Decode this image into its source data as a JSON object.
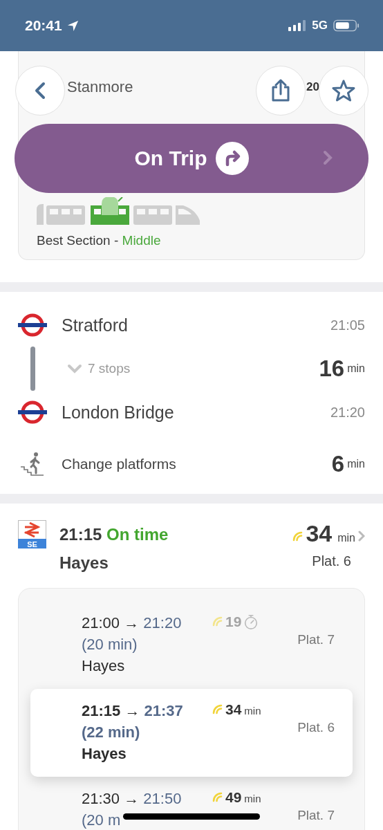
{
  "status_bar": {
    "time": "20:41",
    "network": "5G"
  },
  "trip_header": {
    "origin": "Stanmore",
    "time_fragment": "20",
    "on_trip_button": "On Trip",
    "best_section_label": "Best Section - ",
    "best_section_value": "Middle"
  },
  "leg": {
    "from": {
      "name": "Stratford",
      "time": "21:05"
    },
    "stops": "7 stops",
    "duration": "16",
    "duration_unit": "min",
    "to": {
      "name": "London Bridge",
      "time": "21:20"
    }
  },
  "transfer": {
    "label": "Change platforms",
    "duration": "6",
    "duration_unit": "min"
  },
  "train": {
    "operator": "SE",
    "departure": "21:15",
    "status": "On time",
    "destination": "Hayes",
    "realtime": "34",
    "realtime_unit": "min",
    "platform": "Plat. 6",
    "options": [
      {
        "kind": "past",
        "departure": "21:00",
        "arrow": "→",
        "arrival": "21:20",
        "duration": "(20 min)",
        "destination": "Hayes",
        "realtime": "19",
        "platform": "Plat. 7",
        "selected": false
      },
      {
        "kind": "upcoming",
        "departure": "21:15",
        "arrow": "→",
        "arrival": "21:37",
        "duration": "(22 min)",
        "destination": "Hayes",
        "realtime": "34",
        "realtime_unit": "min",
        "platform": "Plat. 6",
        "selected": true
      },
      {
        "kind": "upcoming",
        "departure": "21:30",
        "arrow": "→",
        "arrival": "21:50",
        "duration": "(20 m",
        "realtime": "49",
        "realtime_unit": "min",
        "platform": "Plat. 7",
        "selected": false
      }
    ]
  }
}
